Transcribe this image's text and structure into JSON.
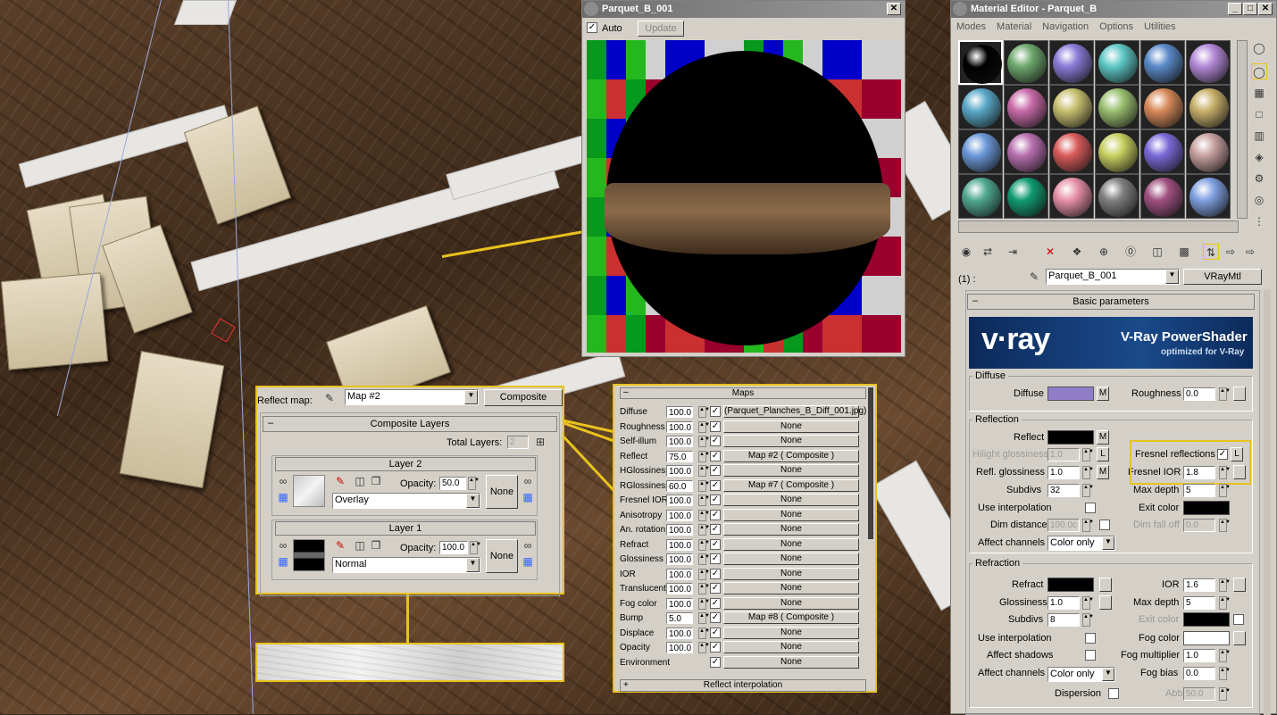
{
  "preview_window": {
    "title": "Parquet_B_001",
    "auto_label": "Auto",
    "update_label": "Update"
  },
  "material_editor": {
    "title": "Material Editor - Parquet_B",
    "menu": [
      "Modes",
      "Material",
      "Navigation",
      "Options",
      "Utilities"
    ],
    "slot_colors": [
      "#000000",
      "#6ea86e",
      "#8a7ad8",
      "#5ec8c6",
      "#5a8ac8",
      "#b48ad8",
      "#5aa8c8",
      "#c86aa8",
      "#c8c070",
      "#9ac070",
      "#d88a5a",
      "#c8b06a",
      "#6a98d8",
      "#b870b0",
      "#d85a5a",
      "#c8d060",
      "#7a6ad8",
      "#c8a0a0",
      "#50a890",
      "#109a70",
      "#e890a8",
      "#808080",
      "#a05080",
      "#80a0e0"
    ],
    "slot_label": "(1) :",
    "material_name": "Parquet_B_001",
    "material_type": "VRayMtl",
    "basic_parameters": "Basic parameters",
    "banner_logo": "v·ray",
    "banner_title": "V-Ray PowerShader",
    "banner_sub": "optimized for V-Ray",
    "diffuse": {
      "group": "Diffuse",
      "label": "Diffuse",
      "m": "M",
      "roughness_label": "Roughness",
      "roughness": "0.0",
      "color": "#8f7dc8"
    },
    "reflection": {
      "group": "Reflection",
      "reflect_label": "Reflect",
      "reflect_m": "M",
      "hilight_label": "Hilight glossiness",
      "hilight": "1.0",
      "l": "L",
      "fresnel_label": "Fresnel reflections",
      "fresnel_l": "L",
      "refl_gloss_label": "Refl. glossiness",
      "refl_gloss": "1.0",
      "refl_gloss_m": "M",
      "fresnel_ior_label": "Fresnel IOR",
      "fresnel_ior": "1.8",
      "subdivs_label": "Subdivs",
      "subdivs": "32",
      "max_depth_label": "Max depth",
      "max_depth": "5",
      "interp_label": "Use interpolation",
      "exit_label": "Exit color",
      "dim_dist_label": "Dim distance",
      "dim_dist": "100.0c",
      "dim_falloff_label": "Dim fall off",
      "dim_falloff": "0.0",
      "affect_label": "Affect channels",
      "affect": "Color only"
    },
    "refraction": {
      "group": "Refraction",
      "refract_label": "Refract",
      "ior_label": "IOR",
      "ior": "1.6",
      "gloss_label": "Glossiness",
      "gloss": "1.0",
      "max_depth_label": "Max depth",
      "max_depth": "5",
      "subdivs_label": "Subdivs",
      "subdivs": "8",
      "exit_label": "Exit color",
      "interp_label": "Use interpolation",
      "fog_color_label": "Fog color",
      "shadows_label": "Affect shadows",
      "fog_mult_label": "Fog multiplier",
      "fog_mult": "1.0",
      "affect_label": "Affect channels",
      "affect": "Color only",
      "fog_bias_label": "Fog bias",
      "fog_bias": "0.0",
      "dispersion_label": "Dispersion",
      "abbe_label": "Abbe",
      "abbe": "50.0"
    }
  },
  "composite": {
    "reflect_map_label": "Reflect map:",
    "map_name": "Map #2",
    "type_button": "Composite",
    "rollout": "Composite Layers",
    "total_label": "Total Layers:",
    "total": "2",
    "layer2": {
      "title": "Layer 2",
      "opacity_label": "Opacity:",
      "opacity": "50.0",
      "blend": "Overlay",
      "none": "None"
    },
    "layer1": {
      "title": "Layer 1",
      "opacity_label": "Opacity:",
      "opacity": "100.0",
      "blend": "Normal",
      "none": "None"
    }
  },
  "maps": {
    "title": "Maps",
    "rows": [
      {
        "label": "Diffuse",
        "value": "100.0",
        "map": "(Parquet_Planches_B_Diff_001.jpg)"
      },
      {
        "label": "Roughness",
        "value": "100.0",
        "map": "None"
      },
      {
        "label": "Self-illum",
        "value": "100.0",
        "map": "None"
      },
      {
        "label": "Reflect",
        "value": "75.0",
        "map": "Map #2  ( Composite )"
      },
      {
        "label": "HGlossiness",
        "value": "100.0",
        "map": "None"
      },
      {
        "label": "RGlossiness",
        "value": "60.0",
        "map": "Map #7  ( Composite )"
      },
      {
        "label": "Fresnel IOR",
        "value": "100.0",
        "map": "None"
      },
      {
        "label": "Anisotropy",
        "value": "100.0",
        "map": "None"
      },
      {
        "label": "An. rotation",
        "value": "100.0",
        "map": "None"
      },
      {
        "label": "Refract",
        "value": "100.0",
        "map": "None"
      },
      {
        "label": "Glossiness",
        "value": "100.0",
        "map": "None"
      },
      {
        "label": "IOR",
        "value": "100.0",
        "map": "None"
      },
      {
        "label": "Translucent",
        "value": "100.0",
        "map": "None"
      },
      {
        "label": "Fog color",
        "value": "100.0",
        "map": "None"
      },
      {
        "label": "Bump",
        "value": "5.0",
        "map": "Map #8  ( Composite )"
      },
      {
        "label": "Displace",
        "value": "100.0",
        "map": "None"
      },
      {
        "label": "Opacity",
        "value": "100.0",
        "map": "None"
      },
      {
        "label": "Environment",
        "value": "",
        "map": "None"
      }
    ],
    "footer": "Reflect interpolation"
  },
  "colors": {
    "accent": "#e8c21e",
    "panel": "#d4d0c8"
  }
}
